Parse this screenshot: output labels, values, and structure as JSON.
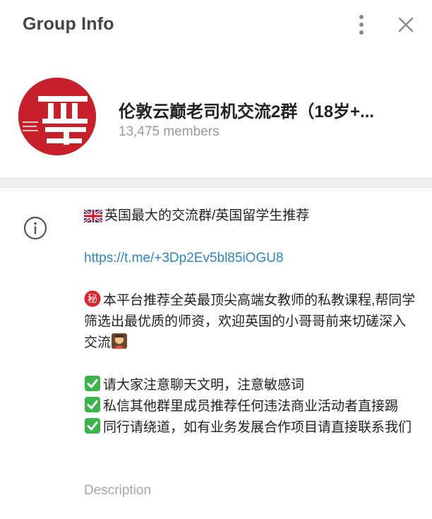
{
  "header": {
    "title": "Group Info"
  },
  "profile": {
    "name": "伦敦云巅老司机交流2群（18岁+...",
    "members": "13,475 members",
    "avatar_color": "#c8202a"
  },
  "description": {
    "line1": "英国最大的交流群/英国留学生推荐",
    "link": "https://t.me/+3Dp2Ev5bl85iOGU8",
    "para2": "本平台推荐全英最顶尖高端女教师的私教课程,帮同学筛选出最优质的师资，欢迎英国的小哥哥前来切磋深入交流",
    "rule1": "请大家注意聊天文明，注意敏感词",
    "rule2": "私信其他群里成员推荐任何违法商业活动者直接踢",
    "rule3": "同行请绕道，如有业务发展合作项目请直接联系我们",
    "caption": "Description",
    "link_color": "#2a86c7"
  },
  "icons": [
    "more-vertical-icon",
    "close-icon",
    "info-icon",
    "uk-flag-icon",
    "secret-icon",
    "teacher-icon",
    "check-icon"
  ]
}
